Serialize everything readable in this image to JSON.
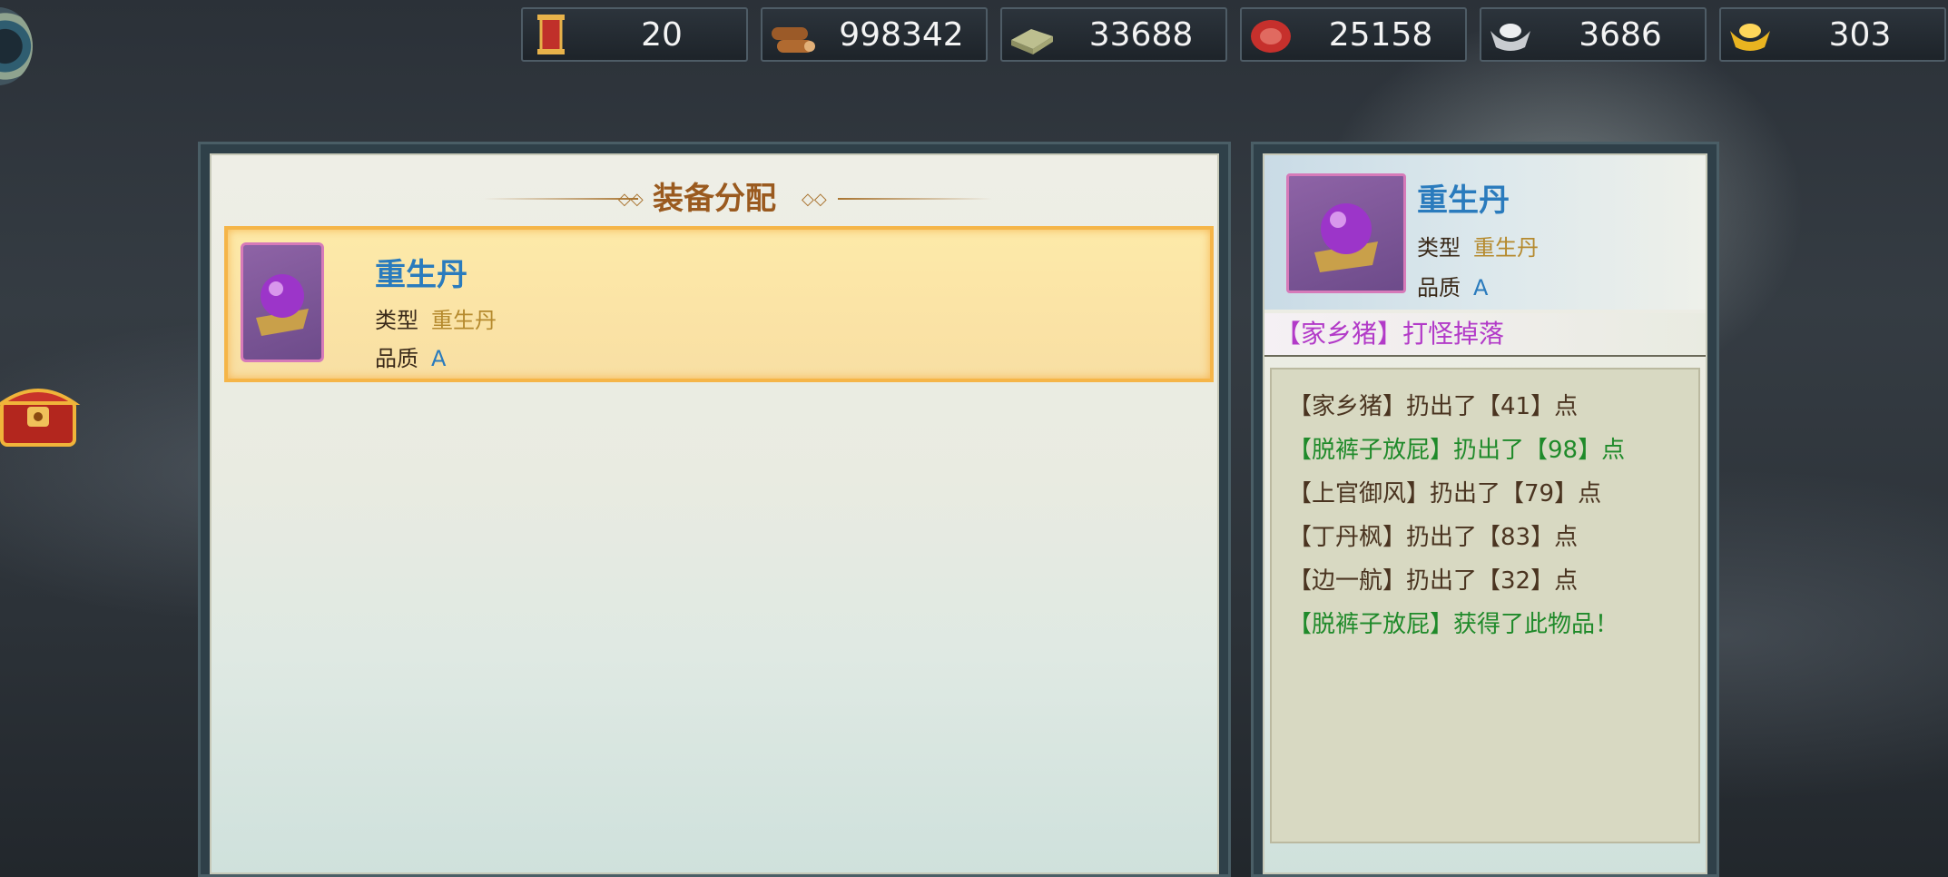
{
  "resources": [
    {
      "icon": "scroll-icon",
      "value": "20"
    },
    {
      "icon": "wood-icon",
      "value": "998342"
    },
    {
      "icon": "stone-icon",
      "value": "33688"
    },
    {
      "icon": "meat-icon",
      "value": "25158"
    },
    {
      "icon": "silver-ingot-icon",
      "value": "3686"
    },
    {
      "icon": "gold-ingot-icon",
      "value": "303"
    }
  ],
  "main_panel": {
    "title": "装备分配",
    "item": {
      "name": "重生丹",
      "type_label": "类型",
      "type_value": "重生丹",
      "quality_label": "品质",
      "quality_value": "A"
    }
  },
  "side_panel": {
    "item": {
      "name": "重生丹",
      "type_label": "类型",
      "type_value": "重生丹",
      "quality_label": "品质",
      "quality_value": "A"
    },
    "drop_title": "【家乡猪】打怪掉落",
    "log": [
      {
        "text": "【家乡猪】扔出了【41】点",
        "color": "brown"
      },
      {
        "text": "【脱裤子放屁】扔出了【98】点",
        "color": "green"
      },
      {
        "text": "【上官御风】扔出了【79】点",
        "color": "brown"
      },
      {
        "text": "【丁丹枫】扔出了【83】点",
        "color": "brown"
      },
      {
        "text": "【边一航】扔出了【32】点",
        "color": "brown"
      },
      {
        "text": "【脱裤子放屁】获得了此物品！",
        "color": "green"
      }
    ]
  }
}
